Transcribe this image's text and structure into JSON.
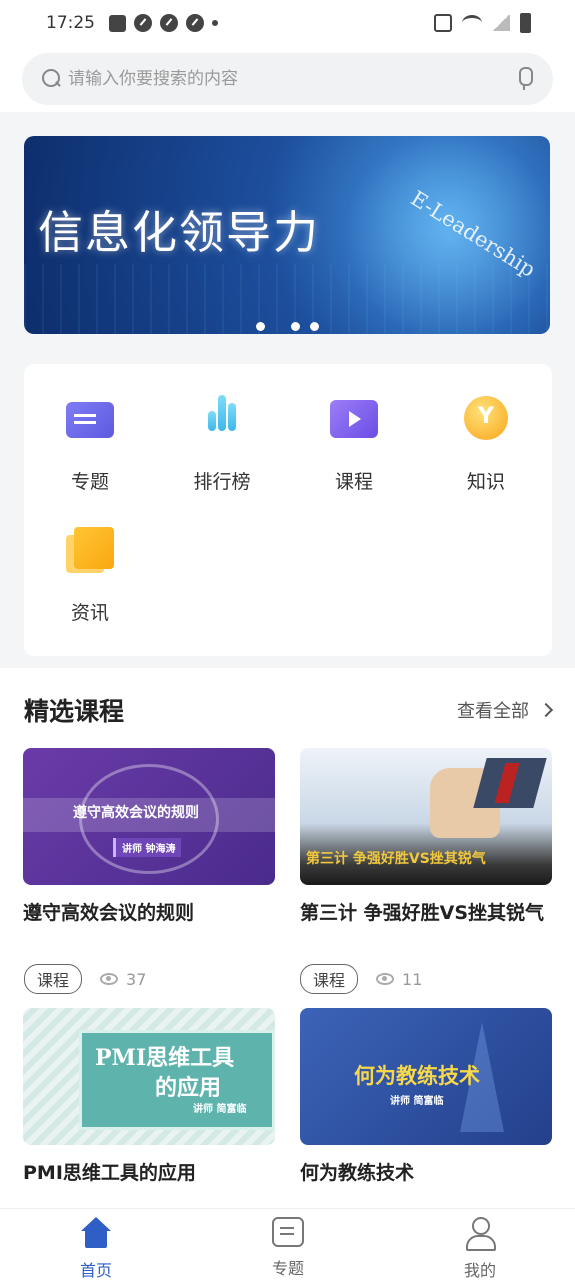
{
  "status_bar": {
    "time": "17:25"
  },
  "search": {
    "placeholder": "请输入你要搜索的内容"
  },
  "banner": {
    "title": "信息化领导力",
    "subtitle": "E-Leadership"
  },
  "menu": {
    "items": [
      {
        "label": "专题",
        "icon": "topic-icon"
      },
      {
        "label": "排行榜",
        "icon": "ranking-icon"
      },
      {
        "label": "课程",
        "icon": "course-icon"
      },
      {
        "label": "知识",
        "icon": "knowledge-icon"
      },
      {
        "label": "资讯",
        "icon": "news-icon"
      }
    ]
  },
  "section": {
    "title": "精选课程",
    "view_all": "查看全部"
  },
  "courses": [
    {
      "title": "遵守高效会议的规则",
      "thumb_text": "遵守高效会议的规则",
      "thumb_sub": "讲师 钟海涛",
      "tag": "课程",
      "views": "37"
    },
    {
      "title": "第三计 争强好胜VS挫其锐气",
      "thumb_text": "第三计 争强好胜VS挫其锐气",
      "tag": "课程",
      "views": "11"
    },
    {
      "title": "PMI思维工具的应用",
      "thumb_text": "PMI思维工具",
      "thumb_text2": "的应用",
      "thumb_sub": "讲师 简富临"
    },
    {
      "title": "何为教练技术",
      "thumb_text": "何为教练技术",
      "thumb_sub": "讲师 简富临"
    }
  ],
  "tabbar": {
    "items": [
      {
        "label": "首页",
        "icon": "home-icon"
      },
      {
        "label": "专题",
        "icon": "topic-icon"
      },
      {
        "label": "我的",
        "icon": "user-icon"
      }
    ]
  },
  "colors": {
    "accent": "#2f5fc6",
    "background": "#f4f5f7"
  }
}
